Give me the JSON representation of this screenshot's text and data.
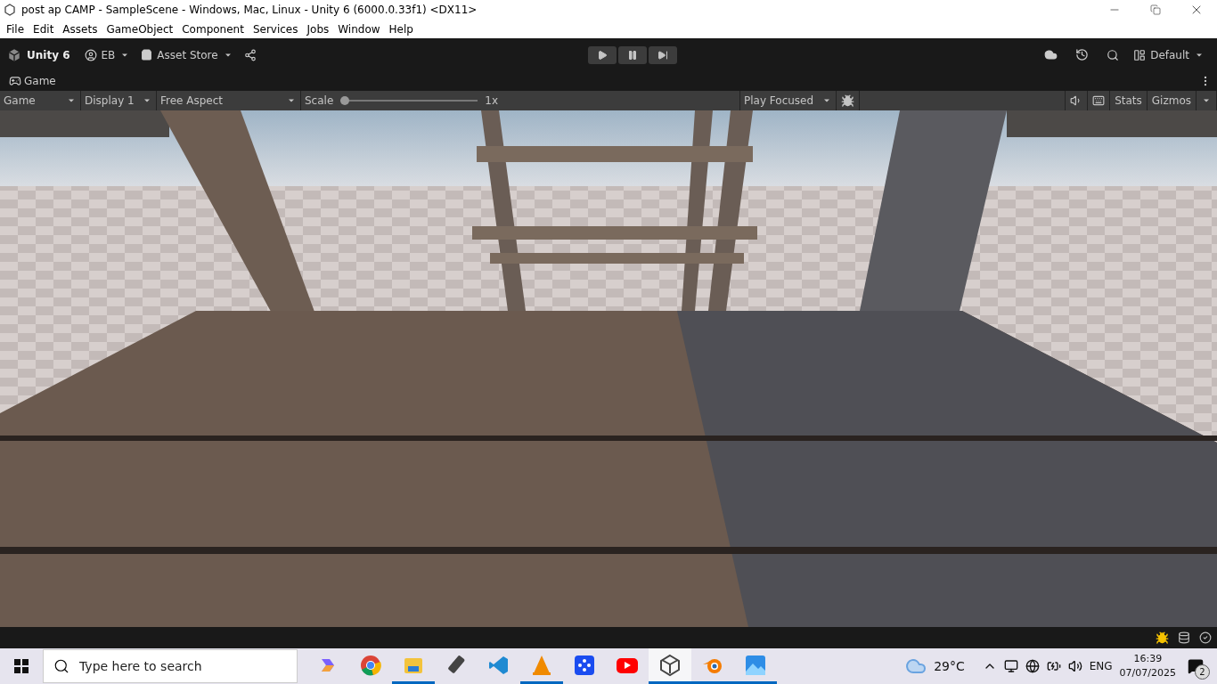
{
  "window": {
    "title": "post ap CAMP - SampleScene - Windows, Mac, Linux - Unity 6 (6000.0.33f1) <DX11>"
  },
  "menu": [
    "File",
    "Edit",
    "Assets",
    "GameObject",
    "Component",
    "Services",
    "Jobs",
    "Window",
    "Help"
  ],
  "toolbar": {
    "brand": "Unity 6",
    "account": "EB",
    "asset_store": "Asset Store",
    "layout": "Default"
  },
  "game_tab": {
    "label": "Game"
  },
  "game_toolbar": {
    "view": "Game",
    "display": "Display 1",
    "aspect": "Free Aspect",
    "scale_label": "Scale",
    "scale": {
      "level": 0.0
    },
    "scale_value": "1x",
    "play_mode": "Play Focused",
    "stats": "Stats",
    "gizmos": "Gizmos"
  },
  "taskbar": {
    "search_placeholder": "Type here to search",
    "apps": [
      {
        "kind": "copilot",
        "running": false,
        "selected": false
      },
      {
        "kind": "chrome",
        "running": false,
        "selected": false
      },
      {
        "kind": "folder",
        "running": true,
        "selected": false
      },
      {
        "kind": "usb",
        "running": false,
        "selected": false
      },
      {
        "kind": "vscode",
        "running": false,
        "selected": false
      },
      {
        "kind": "vlc",
        "running": true,
        "selected": false
      },
      {
        "kind": "dots",
        "running": false,
        "selected": false
      },
      {
        "kind": "youtube",
        "running": false,
        "selected": false
      },
      {
        "kind": "unity",
        "running": true,
        "selected": true
      },
      {
        "kind": "blender",
        "running": true,
        "selected": false
      },
      {
        "kind": "photos",
        "running": true,
        "selected": false
      }
    ],
    "temperature": "29°C",
    "language": "ENG",
    "time": "16:39",
    "date": "07/07/2025",
    "notifications": "2"
  }
}
